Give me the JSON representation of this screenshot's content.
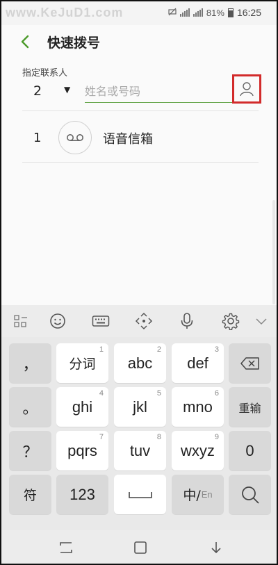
{
  "status_bar": {
    "watermark": "www.KeJuD1.com",
    "battery": "81%",
    "time": "16:25"
  },
  "header": {
    "title": "快速拨号",
    "back_icon": "chevron-left-icon"
  },
  "form": {
    "assign_label": "指定联系人",
    "number_value": "2",
    "contact_placeholder": "姓名或号码",
    "contact_icon": "person-icon"
  },
  "list": {
    "items": [
      {
        "number": "1",
        "label": "语音信箱",
        "icon": "voicemail-icon"
      }
    ]
  },
  "keyboard": {
    "toolbar_icons": [
      "grid-icon",
      "emoji-icon",
      "keyboard-icon",
      "move-icon",
      "mic-icon",
      "gear-icon",
      "chevron-down-icon"
    ],
    "rows": [
      [
        {
          "main": "，",
          "sub": ""
        },
        {
          "main": "分词",
          "sub": "1"
        },
        {
          "main": "abc",
          "sub": "2"
        },
        {
          "main": "def",
          "sub": "3"
        },
        {
          "main": "",
          "sub": "",
          "icon": "backspace-icon"
        }
      ],
      [
        {
          "main": "。",
          "sub": ""
        },
        {
          "main": "ghi",
          "sub": "4"
        },
        {
          "main": "jkl",
          "sub": "5"
        },
        {
          "main": "mno",
          "sub": "6"
        },
        {
          "main": "重输",
          "sub": ""
        }
      ],
      [
        {
          "main": "？",
          "sub": ""
        },
        {
          "main": "pqrs",
          "sub": "7"
        },
        {
          "main": "tuv",
          "sub": "8"
        },
        {
          "main": "wxyz",
          "sub": "9"
        },
        {
          "main": "0",
          "sub": ""
        }
      ],
      [
        {
          "main": "符",
          "sub": ""
        },
        {
          "main": "123",
          "sub": ""
        },
        {
          "main": "",
          "sub": "",
          "icon": "space-icon"
        },
        {
          "main": "中/",
          "sub": "",
          "en": "En"
        },
        {
          "main": "",
          "sub": "",
          "icon": "search-icon"
        }
      ]
    ]
  },
  "navbar": {
    "icons": [
      "recent-apps-icon",
      "home-icon",
      "back-icon"
    ]
  }
}
